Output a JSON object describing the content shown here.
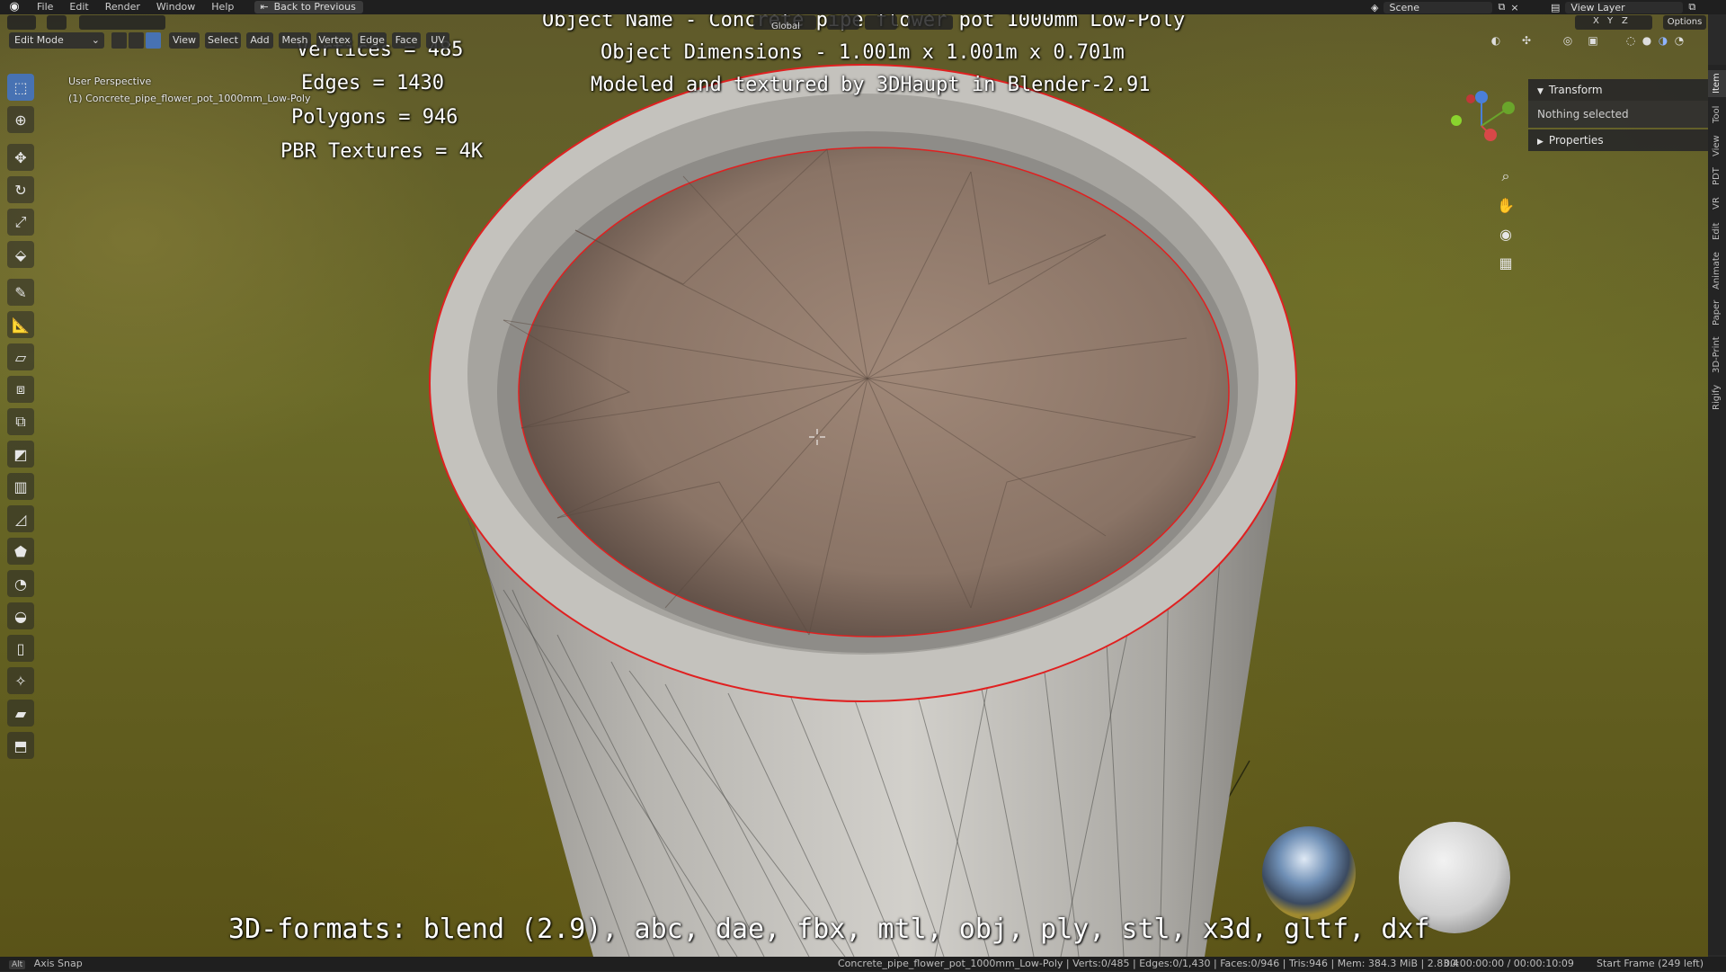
{
  "menubar": {
    "items": [
      "File",
      "Edit",
      "Render",
      "Window",
      "Help"
    ],
    "back_button": "Back to Previous",
    "scene_label": "Scene",
    "view_layer_label": "View Layer"
  },
  "viewport_header": {
    "mode": "Edit Mode",
    "menus": [
      "View",
      "Select",
      "Add",
      "Mesh",
      "Vertex",
      "Edge",
      "Face",
      "UV"
    ],
    "transform_orientation": "Global",
    "options_label": "Options",
    "axis_labels": [
      "X",
      "Y",
      "Z"
    ]
  },
  "viewport_info": {
    "perspective": "User Perspective",
    "object": "(1) Concrete_pipe_flower_pot_1000mm_Low-Poly"
  },
  "stats_overlay": {
    "vertices": "Vertices = 485",
    "edges": "Edges = 1430",
    "polygons": "Polygons = 946",
    "textures": "PBR Textures = 4K"
  },
  "object_overlay": {
    "name": "Object Name - Concrete pipe flower pot 1000mm Low-Poly",
    "dimensions": "Object Dimensions -  1.001m x 1.001m x 0.701m",
    "credit": "Modeled and textured by 3DHaupt in Blender-2.91"
  },
  "formats_overlay": "3D-formats: blend (2.9), abc, dae, fbx, mtl, obj, ply, stl, x3d, gltf, dxf",
  "sidebar_panel": {
    "transform_header": "Transform",
    "transform_body": "Nothing selected",
    "properties_header": "Properties"
  },
  "sidebar_tabs": [
    "Item",
    "Tool",
    "View",
    "PDT",
    "VR",
    "Edit",
    "Animate",
    "Paper",
    "3D-Print",
    "Rigify"
  ],
  "statusbar": {
    "hint_key": "Alt",
    "hint": "Axis Snap",
    "stats": "Concrete_pipe_flower_pot_1000mm_Low-Poly | Verts:0/485 | Edges:0/1,430 | Faces:0/946 | Tris:946 | Mem: 384.3 MiB | 2.83.4",
    "time": "00:00:00:00 / 00:00:10:09",
    "frame": "Start Frame (249 left)"
  },
  "colors": {
    "accent": "#4772b3",
    "selection_outline": "#e02020",
    "viewport_bg": "#6a6a28"
  }
}
